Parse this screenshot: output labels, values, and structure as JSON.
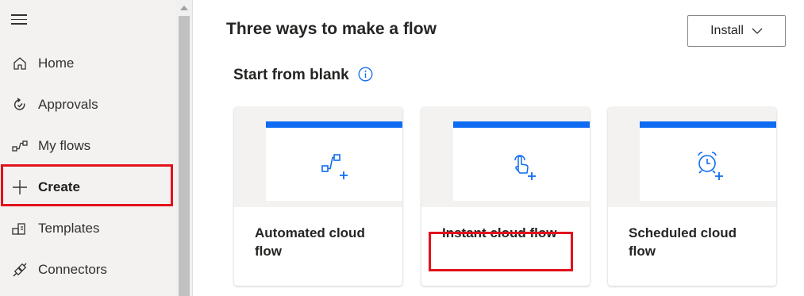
{
  "sidebar": {
    "items": [
      {
        "label": "Home",
        "icon": "home-icon"
      },
      {
        "label": "Approvals",
        "icon": "approvals-icon"
      },
      {
        "label": "My flows",
        "icon": "my-flows-icon"
      },
      {
        "label": "Create",
        "icon": "plus-icon",
        "active": true
      },
      {
        "label": "Templates",
        "icon": "templates-icon"
      },
      {
        "label": "Connectors",
        "icon": "connectors-icon"
      }
    ]
  },
  "header": {
    "title": "Three ways to make a flow",
    "install_label": "Install"
  },
  "section": {
    "title": "Start from blank"
  },
  "cards": [
    {
      "label": "Automated cloud flow",
      "icon": "automated-flow-icon"
    },
    {
      "label": "Instant cloud flow",
      "icon": "instant-flow-icon"
    },
    {
      "label": "Scheduled cloud flow",
      "icon": "scheduled-flow-icon"
    }
  ],
  "colors": {
    "accent": "#0f6cf2",
    "highlight": "#e3121c",
    "sidebar_bg": "#f3f2f1"
  }
}
